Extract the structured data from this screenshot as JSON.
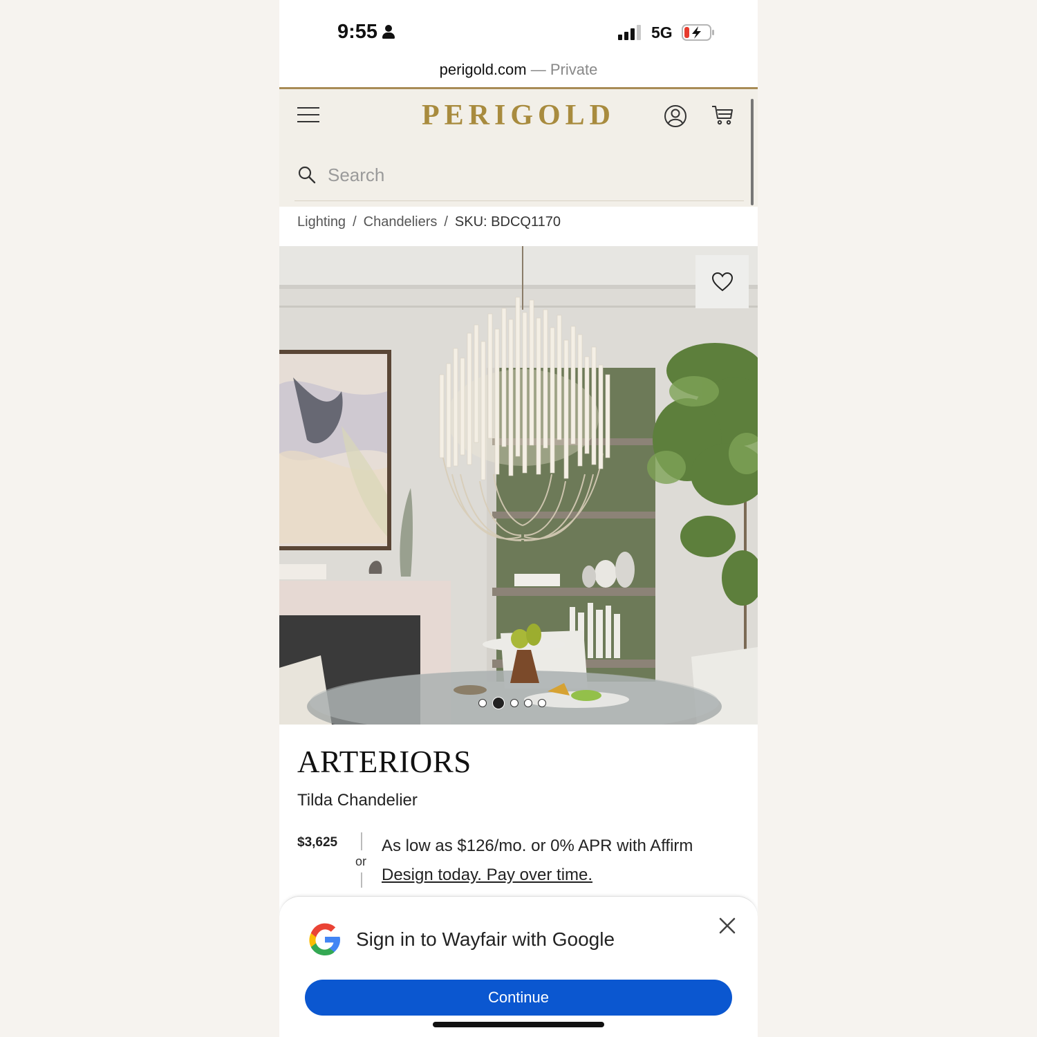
{
  "status_bar": {
    "time": "9:55",
    "network": "5G",
    "battery_color": "#e63b2e"
  },
  "browser": {
    "domain": "perigold.com",
    "mode": "— Private"
  },
  "header": {
    "logo": "PERIGOLD",
    "search_placeholder": "Search",
    "accent_color": "#a88b3e"
  },
  "breadcrumb": {
    "items": [
      "Lighting",
      "Chandeliers"
    ],
    "sku": "SKU: BDCQ1170",
    "separator": "/"
  },
  "gallery": {
    "image_count": 5,
    "active_index": 1
  },
  "product": {
    "brand": "ARTERIORS",
    "name": "Tilda Chandelier",
    "price": "$3,625",
    "or_label": "or",
    "financing_text": "As low as $126/mo. or 0% APR with Affirm",
    "financing_link": "Design today. Pay over time."
  },
  "google_prompt": {
    "title": "Sign in to Wayfair with Google",
    "button_label": "Continue",
    "button_color": "#0b57d0"
  }
}
